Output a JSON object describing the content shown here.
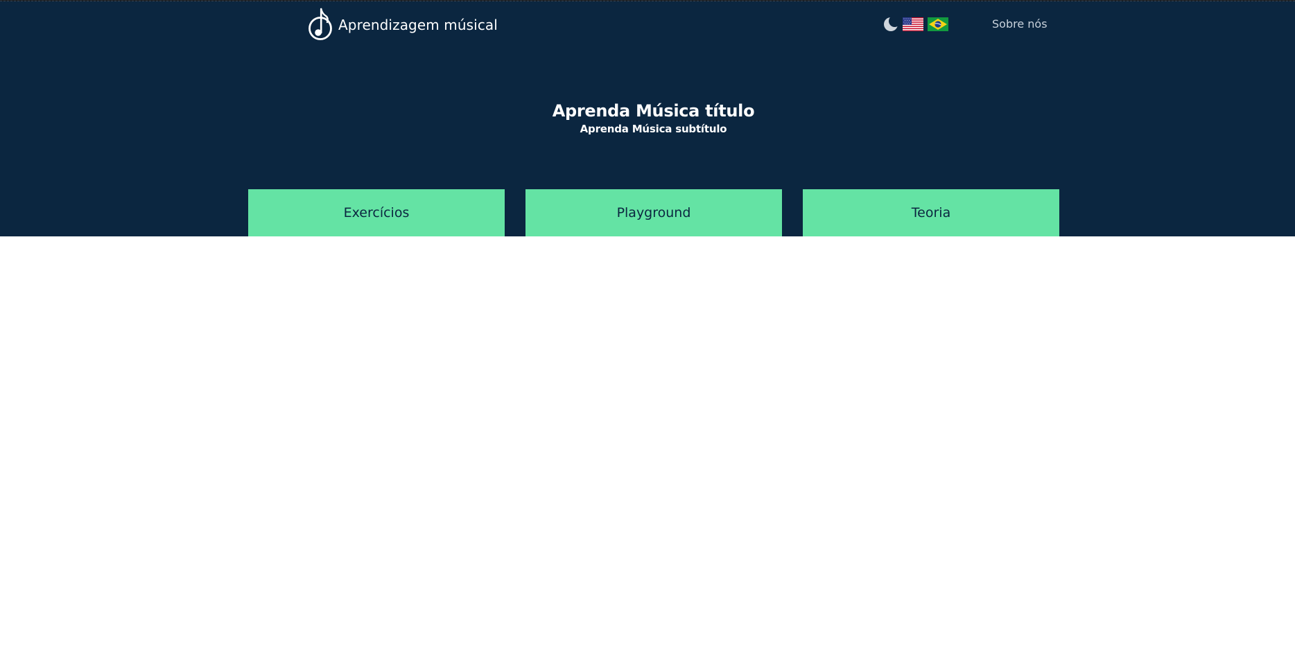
{
  "brand": {
    "icon": "music-note-icon",
    "name": "Aprendizagem músical"
  },
  "controls": {
    "theme_icon": "moon-icon",
    "languages": [
      {
        "code": "en-US",
        "icon": "us-flag-icon"
      },
      {
        "code": "pt-BR",
        "icon": "brazil-flag-icon"
      }
    ]
  },
  "nav": {
    "about_label": "Sobre nós"
  },
  "hero": {
    "title": "Aprenda Música título",
    "subtitle": "Aprenda Música subtítulo"
  },
  "cards": [
    {
      "label": "Exercícios"
    },
    {
      "label": "Playground"
    },
    {
      "label": "Teoria"
    }
  ],
  "colors": {
    "header_bg": "#0b2640",
    "card_bg": "#64e3a4",
    "card_text": "#0b2640",
    "page_bg": "#ffffff",
    "about_text": "#c9d2dc"
  }
}
